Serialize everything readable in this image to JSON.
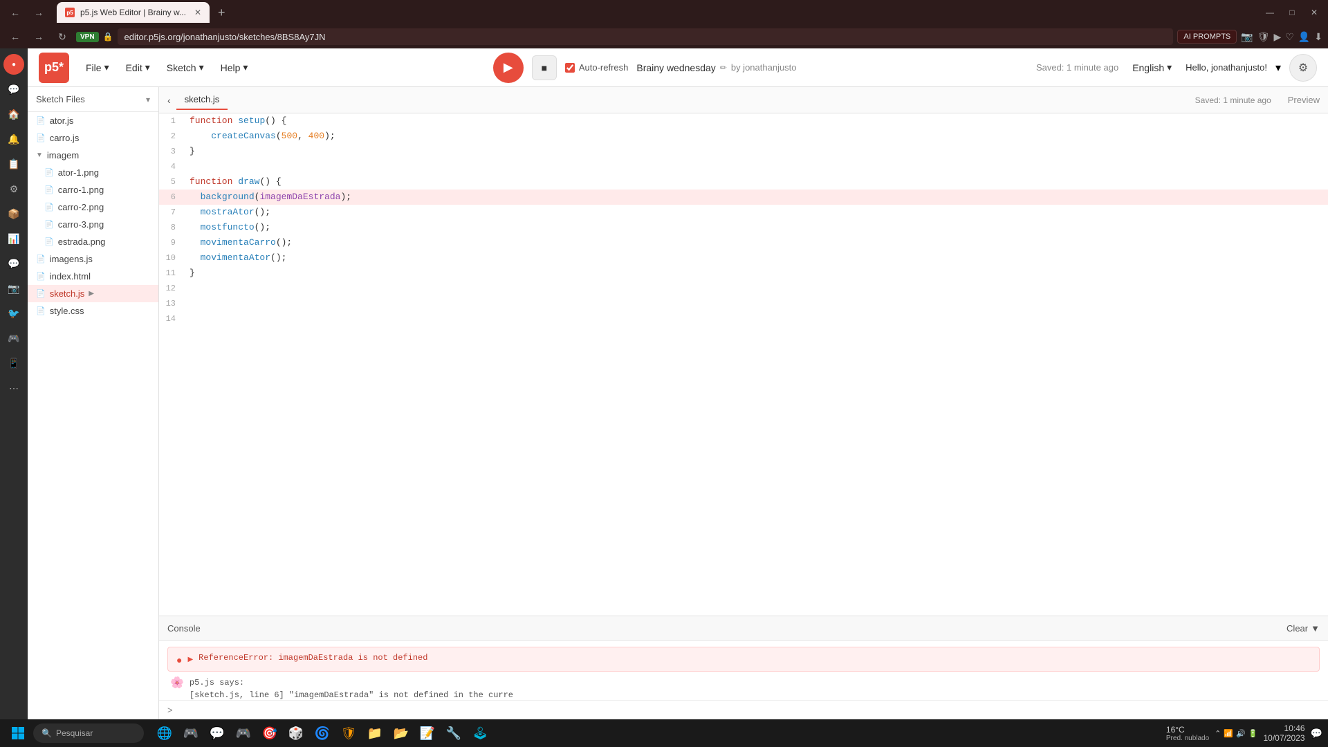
{
  "browser": {
    "tab_title": "p5.js Web Editor | Brainy w...",
    "tab_favicon": "p5",
    "url": "editor.p5js.org/jonathanjusto/sketches/8BS8Ay7JN",
    "vpn_label": "VPN",
    "ai_prompts_label": "AI PROMPTS",
    "new_tab_label": "+"
  },
  "toolbar": {
    "logo": "p5*",
    "file_menu": "File",
    "edit_menu": "Edit",
    "sketch_menu": "Sketch",
    "help_menu": "Help",
    "run_label": "▶",
    "stop_label": "■",
    "auto_refresh_label": "Auto-refresh",
    "auto_refresh_checked": true,
    "sketch_title": "Brainy wednesday",
    "by_label": "by jonathanjusto",
    "saved_status": "Saved: 1 minute ago",
    "preview_label": "Preview",
    "language": "English",
    "user_greeting": "Hello, jonathanjusto!"
  },
  "file_tree": {
    "title": "Sketch Files",
    "files": [
      {
        "name": "ator.js",
        "type": "file",
        "active": false,
        "indent": 0
      },
      {
        "name": "carro.js",
        "type": "file",
        "active": false,
        "indent": 0
      },
      {
        "name": "imagem",
        "type": "folder",
        "open": true,
        "indent": 0
      },
      {
        "name": "ator-1.png",
        "type": "file",
        "active": false,
        "indent": 1
      },
      {
        "name": "carro-1.png",
        "type": "file",
        "active": false,
        "indent": 1
      },
      {
        "name": "carro-2.png",
        "type": "file",
        "active": false,
        "indent": 1
      },
      {
        "name": "carro-3.png",
        "type": "file",
        "active": false,
        "indent": 1
      },
      {
        "name": "estrada.png",
        "type": "file",
        "active": false,
        "indent": 1
      },
      {
        "name": "imagens.js",
        "type": "file",
        "active": false,
        "indent": 0
      },
      {
        "name": "index.html",
        "type": "file",
        "active": false,
        "indent": 0
      },
      {
        "name": "sketch.js",
        "type": "file",
        "active": true,
        "indent": 0
      },
      {
        "name": "style.css",
        "type": "file",
        "active": false,
        "indent": 0
      }
    ]
  },
  "code_tab": {
    "filename": "sketch.js",
    "saved_status": "Saved: 1 minute ago",
    "preview_label": "Preview"
  },
  "code": {
    "lines": [
      {
        "num": 1,
        "content": "function setup() {",
        "highlighted": false
      },
      {
        "num": 2,
        "content": "    createCanvas(500, 400);",
        "highlighted": false
      },
      {
        "num": 3,
        "content": "}",
        "highlighted": false
      },
      {
        "num": 4,
        "content": "",
        "highlighted": false
      },
      {
        "num": 5,
        "content": "function draw() {",
        "highlighted": false
      },
      {
        "num": 6,
        "content": "  background(imagemDaEstrada);",
        "highlighted": true
      },
      {
        "num": 7,
        "content": "  mostraAtor();",
        "highlighted": false
      },
      {
        "num": 8,
        "content": "  mostfuncto();",
        "highlighted": false
      },
      {
        "num": 9,
        "content": "  movimentaCarro();",
        "highlighted": false
      },
      {
        "num": 10,
        "content": "  movimentaAtor();",
        "highlighted": false
      },
      {
        "num": 11,
        "content": "}",
        "highlighted": false
      },
      {
        "num": 12,
        "content": "",
        "highlighted": false
      },
      {
        "num": 13,
        "content": "",
        "highlighted": false
      },
      {
        "num": 14,
        "content": "",
        "highlighted": false
      }
    ]
  },
  "console": {
    "title": "Console",
    "clear_label": "Clear",
    "expand_icon": "▼",
    "error_icon": "●",
    "expand_error_icon": "▶",
    "error_message": "ReferenceError: imagemDaEstrada is not defined",
    "p5_flower": "🌸",
    "p5_says": "p5.js says:",
    "p5_note": "[sketch.js, line 6] \"imagemDaEstrada\" is not defined in the curre",
    "prompt_icon": ">"
  },
  "taskbar": {
    "weather_temp": "16°C",
    "weather_desc": "Pred. nublado",
    "search_placeholder": "Pesquisar",
    "clock_time": "10:46",
    "clock_date": "10/07/2023"
  },
  "left_sidebar": {
    "icons": [
      "🌐",
      "💬",
      "📋",
      "⚙",
      "📦",
      "📊",
      "💬",
      "📷",
      "🐦",
      "🎮",
      "📱",
      "⋯"
    ]
  }
}
